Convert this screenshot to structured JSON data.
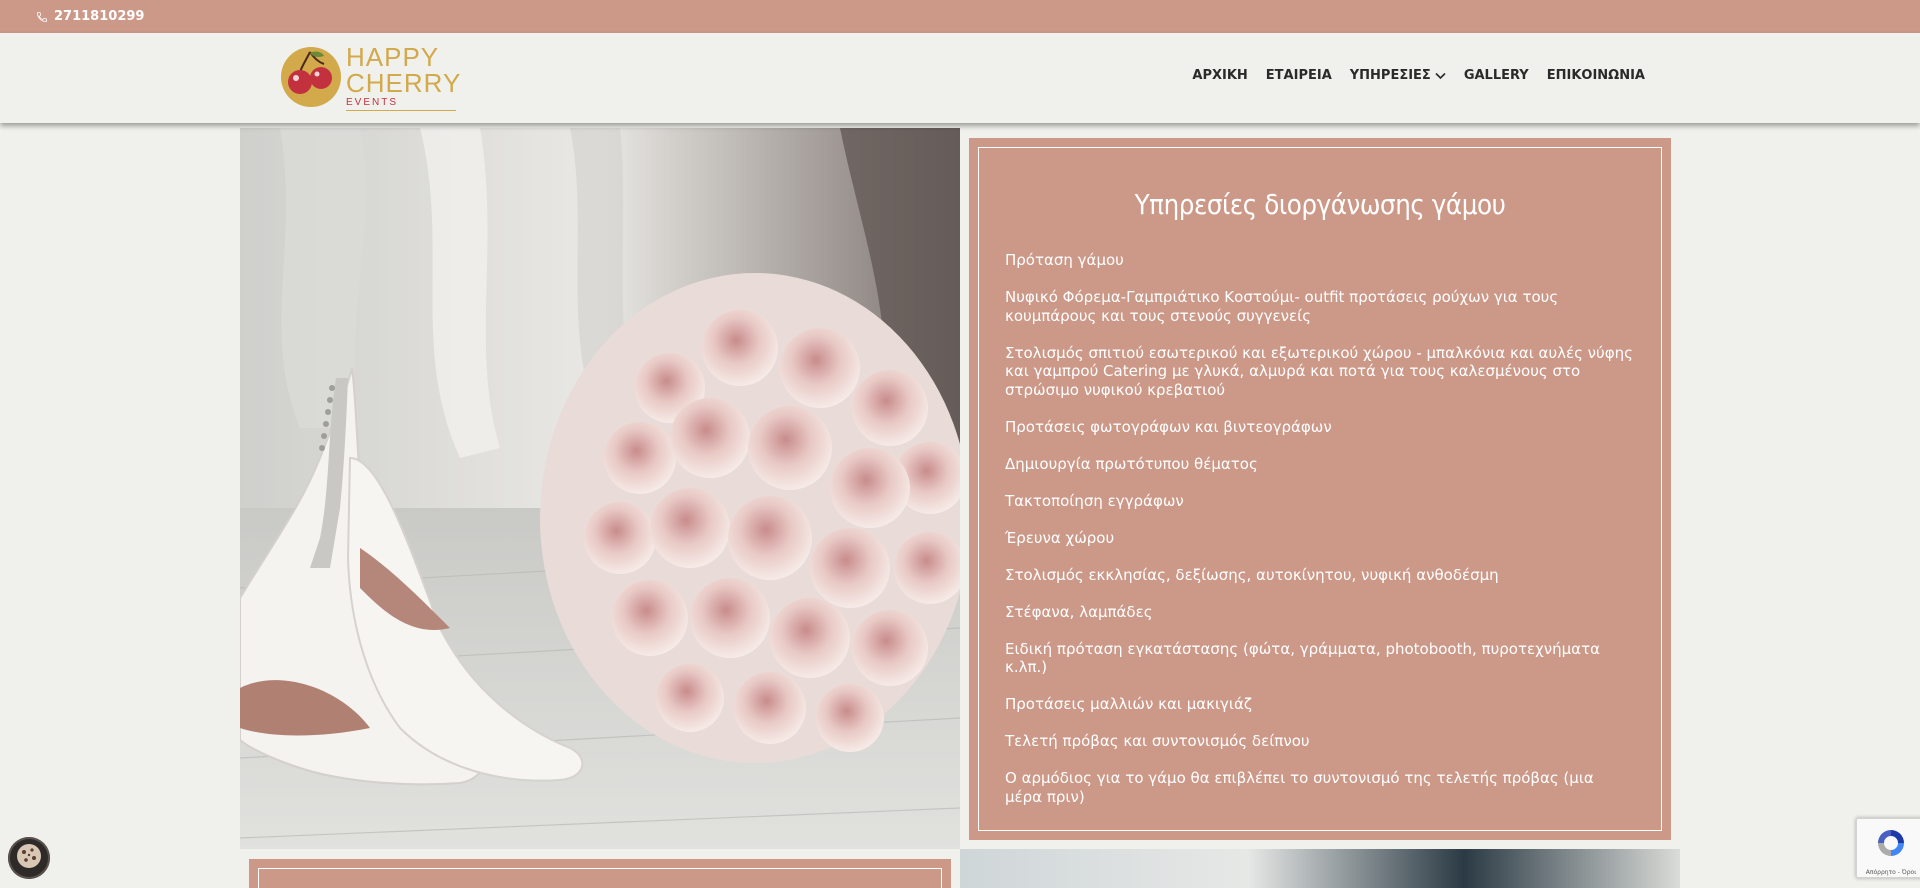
{
  "topbar": {
    "phone": "2711810299",
    "icon": "phone-icon"
  },
  "logo": {
    "line1": "HAPPY",
    "line2": "CHERRY",
    "line3": "EVENTS"
  },
  "nav": {
    "items": [
      {
        "label": "ΑΡΧΙΚΗ"
      },
      {
        "label": "ΕΤΑΙΡΕΙΑ"
      },
      {
        "label": "ΥΠΗΡΕΣΙΕΣ",
        "has_dropdown": true
      },
      {
        "label": "GALLERY"
      },
      {
        "label": "ΕΠΙΚΟΙΝΩΝΙΑ"
      }
    ]
  },
  "services": {
    "title": "Υπηρεσίες διοργάνωσης γάμου",
    "items": [
      "Πρόταση γάμου",
      "Νυφικό Φόρεμα-Γαμπριάτικο Κοστούμι- outfit προτάσεις ρούχων για τους κουμπάρους και τους στενούς συγγενείς",
      "Στολισμός σπιτιού εσωτερικού και εξωτερικού χώρου - μπαλκόνια και αυλές νύφης και γαμπρού Catering με γλυκά, αλμυρά και ποτά για τους καλεσμένους στο στρώσιμο νυφικού κρεβατιού",
      "Προτάσεις φωτογράφων και βιντεογράφων",
      "Δημιουργία πρωτότυπου θέματος",
      "Τακτοποίηση εγγράφων",
      "Έρευνα χώρου",
      "Στολισμός εκκλησίας, δεξίωσης, αυτοκίνητου, νυφική ανθοδέσμη",
      "Στέφανα, λαμπάδες",
      "Ειδική πρόταση εγκατάστασης (φώτα, γράμματα, photobooth, πυροτεχνήματα κ.λπ.)",
      "Προτάσεις μαλλιών και μακιγιάζ",
      "Τελετή πρόβας και συντονισμός δείπνου",
      "Ο αρμόδιος για το γάμο θα επιβλέπει το συντονισμό της τελετής πρόβας (μια μέρα πριν)"
    ]
  },
  "recaptcha": {
    "text": "Απόρρητο - Όροι"
  },
  "colors": {
    "accent": "#cc9888",
    "background": "#f0f1ec",
    "logo_gold": "#d2a94b",
    "logo_red": "#c3313f"
  }
}
